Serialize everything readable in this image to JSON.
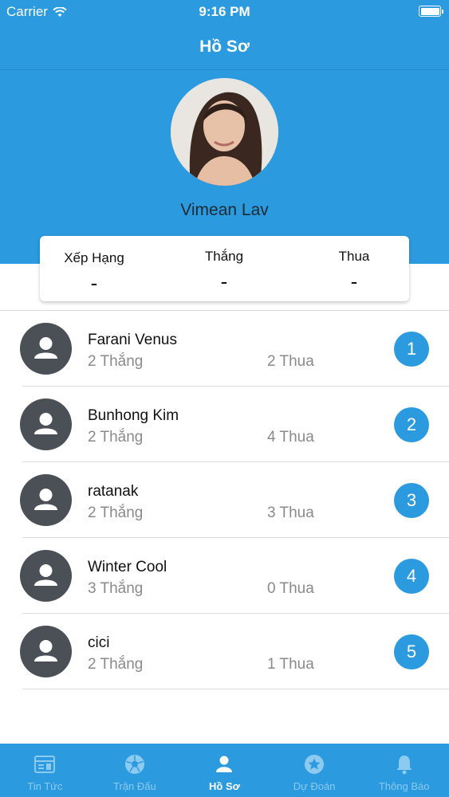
{
  "status_bar": {
    "carrier": "Carrier",
    "time": "9:16 PM"
  },
  "nav": {
    "title": "Hồ Sơ"
  },
  "profile": {
    "name": "Vimean Lav"
  },
  "stats": {
    "rank": {
      "label": "Xếp Hạng",
      "value": "-"
    },
    "wins": {
      "label": "Thắng",
      "value": "-"
    },
    "losses": {
      "label": "Thua",
      "value": "-"
    }
  },
  "leaderboard": [
    {
      "name": "Farani Venus",
      "wins": "2 Thắng",
      "losses": "2 Thua",
      "rank": "1"
    },
    {
      "name": "Bunhong Kim",
      "wins": "2 Thắng",
      "losses": "4 Thua",
      "rank": "2"
    },
    {
      "name": "ratanak",
      "wins": "2 Thắng",
      "losses": "3 Thua",
      "rank": "3"
    },
    {
      "name": "Winter Cool",
      "wins": "3 Thắng",
      "losses": "0 Thua",
      "rank": "4"
    },
    {
      "name": "cici",
      "wins": "2 Thắng",
      "losses": "1 Thua",
      "rank": "5"
    }
  ],
  "tabs": [
    {
      "label": "Tin Tức",
      "icon": "news-icon"
    },
    {
      "label": "Trận Đấu",
      "icon": "soccer-ball-icon"
    },
    {
      "label": "Hồ Sơ",
      "icon": "profile-icon",
      "active": true
    },
    {
      "label": "Dự Đoán",
      "icon": "star-icon"
    },
    {
      "label": "Thông Báo",
      "icon": "bell-icon"
    }
  ],
  "colors": {
    "primary": "#2b9ade",
    "avatar_placeholder": "#4a5056",
    "tab_inactive": "#8ccaf0"
  }
}
